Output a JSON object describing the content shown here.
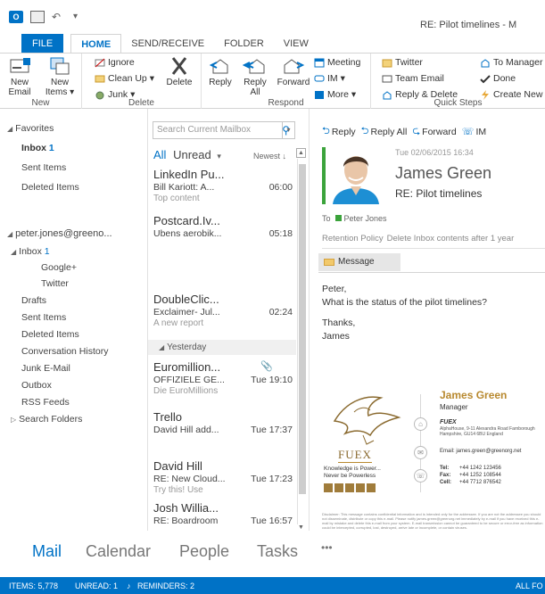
{
  "window": {
    "title": "RE: Pilot timelines - M"
  },
  "tabs": [
    "FILE",
    "HOME",
    "SEND/RECEIVE",
    "FOLDER",
    "VIEW"
  ],
  "ribbon": {
    "new_email": [
      "New",
      "Email"
    ],
    "new_items": [
      "New",
      "Items ▾"
    ],
    "new_group": "New",
    "ignore": "Ignore",
    "clean_up": "Clean Up ▾",
    "junk": "Junk ▾",
    "delete": "Delete",
    "delete_group": "Delete",
    "reply": "Reply",
    "reply_all": [
      "Reply",
      "All"
    ],
    "forward": "Forward",
    "meeting": "Meeting",
    "im": "IM ▾",
    "more": "More ▾",
    "respond_group": "Respond",
    "twitter": "Twitter",
    "team_email": "Team Email",
    "reply_delete": "Reply & Delete",
    "to_manager": "To Manager",
    "done": "Done",
    "create_new": "Create New",
    "quick_steps_group": "Quick Steps"
  },
  "nav": {
    "favorites": "Favorites",
    "inbox": "Inbox",
    "inbox_count": "1",
    "sent": "Sent Items",
    "deleted": "Deleted Items",
    "account": "peter.jones@greeno...",
    "inbox2": "Inbox",
    "inbox2_count": "1",
    "google": "Google+",
    "twitter": "Twitter",
    "drafts": "Drafts",
    "sent2": "Sent Items",
    "deleted2": "Deleted Items",
    "conv": "Conversation History",
    "junk": "Junk E-Mail",
    "outbox": "Outbox",
    "rss": "RSS Feeds",
    "search_folders": "Search Folders"
  },
  "list": {
    "search_placeholder": "Search Current Mailbox",
    "filter_all": "All",
    "filter_unread": "Unread",
    "sort": "Newest ↓",
    "group_yesterday": "Yesterday",
    "mails": [
      {
        "from": "LinkedIn Pu...",
        "subject": "Bill Kariott: A...",
        "time": "06:00",
        "preview": "Top content"
      },
      {
        "from": "Postcard.Iv...",
        "subject": "Ubens aerobik...",
        "time": "05:18",
        "preview": ""
      },
      {
        "from": "DoubleClic...",
        "subject": "Exclaimer- Jul...",
        "time": "02:24",
        "preview": "A new report"
      },
      {
        "from": "Euromillion...",
        "subject": "OFFIZIELE GE...",
        "time": "Tue 19:10",
        "preview": "Die EuroMillions"
      },
      {
        "from": "Trello",
        "subject": "David Hill add...",
        "time": "Tue 17:37",
        "preview": ""
      },
      {
        "from": "David Hill",
        "subject": "RE: New Cloud...",
        "time": "Tue 17:23",
        "preview": "Try this! Use"
      },
      {
        "from": "Josh Willia...",
        "subject": "RE: Boardroom",
        "time": "Tue 16:57",
        "preview": ""
      }
    ]
  },
  "reading": {
    "reply": "Reply",
    "reply_all": "Reply All",
    "forward": "Forward",
    "im": "IM",
    "date": "Tue 02/06/2015 16:34",
    "sender": "James Green",
    "subject": "RE: Pilot timelines",
    "to_label": "To",
    "to_name": "Peter Jones",
    "retention_label": "Retention Policy",
    "retention_value": "Delete Inbox contents after 1 year",
    "message_tab": "Message",
    "body": [
      "Peter,",
      "What is the status of the pilot timelines?",
      "Thanks,",
      "James"
    ],
    "sig": {
      "name": "James Green",
      "role": "Manager",
      "company": "FUEX",
      "address": "AlphaHouse, 9-11 Alexandra Road Farnborough Hampshire, GU14 6BU England",
      "email": "Email: james.green@greenorg.net",
      "tel_label": "Tel:",
      "tel": "+44 1242 123456",
      "fax_label": "Fax:",
      "fax": "+44 1252 108544",
      "cell_label": "Cell:",
      "cell": "+44 7712 876542",
      "logo_text": "FUEX",
      "tagline1": "Knowledge is Power...",
      "tagline2": "Never be Powerless"
    },
    "disclaimer": "Disclaimer: This message contains confidential information and is intended only for the addressee. If you are not the addressee you should not disseminate, distribute or copy this e-mail. Please notify james.green@greenorg.net immediately by e-mail if you have received this e-mail by mistake and delete this e-mail from your system. E-mail transmission cannot be guaranteed to be secure or error-free as information could be intercepted, corrupted, lost, destroyed, arrive late or incomplete, or contain viruses."
  },
  "bottom_nav": [
    "Mail",
    "Calendar",
    "People",
    "Tasks",
    "•••"
  ],
  "status": {
    "items": "ITEMS: 5,778",
    "unread": "UNREAD: 1",
    "reminders": "REMINDERS: 2",
    "right": "ALL FO"
  },
  "colors": {
    "accent": "#0072c6",
    "presence": "#3ba33b",
    "signature": "#b8892f"
  }
}
